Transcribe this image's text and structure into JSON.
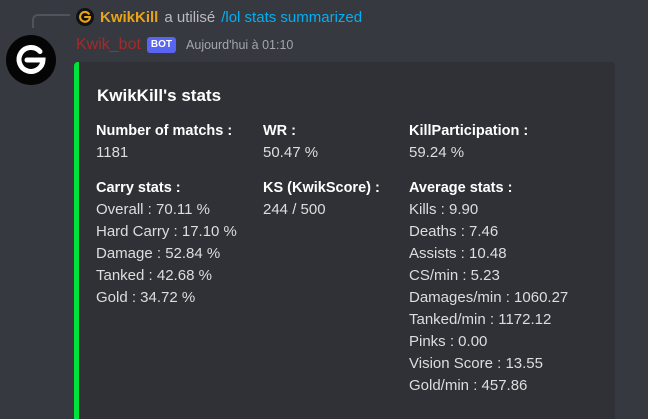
{
  "reply": {
    "user_name": "KwikKill",
    "verb": "a utilisé",
    "command": "/lol stats summarized"
  },
  "author": {
    "name": "Kwik_bot",
    "tag": "BOT",
    "timestamp": "Aujourd'hui à 01:10"
  },
  "embed": {
    "accent_color": "#00e33a",
    "title": "KwikKill's stats",
    "fields": {
      "matches": {
        "name": "Number of matchs :",
        "value": "1181"
      },
      "wr": {
        "name": "WR :",
        "value": "50.47 %"
      },
      "kp": {
        "name": "KillParticipation :",
        "value": "59.24 %"
      },
      "carry": {
        "name": "Carry stats :",
        "lines": [
          "Overall : 70.11 %",
          "Hard Carry : 17.10 %",
          "Damage : 52.84 %",
          "Tanked : 42.68 %",
          "Gold : 34.72 %"
        ]
      },
      "ks": {
        "name": "KS (KwikScore) :",
        "value": "244 / 500"
      },
      "average": {
        "name": "Average stats :",
        "lines": [
          "Kills : 9.90",
          "Deaths : 7.46",
          "Assists : 10.48",
          "CS/min : 5.23",
          "Damages/min : 1060.27",
          "Tanked/min : 1172.12",
          "Pinks : 0.00",
          "Vision Score : 13.55",
          "Gold/min : 457.86"
        ]
      }
    }
  },
  "colors": {
    "background": "#36393f",
    "embed_bg": "#2f3136",
    "bot_name": "#a52a2a",
    "reply_user": "#e8a317",
    "command": "#00b0f4",
    "bot_tag": "#5865f2"
  },
  "icons": {
    "avatar": "g-logo-icon",
    "reply_avatar": "g-logo-icon"
  }
}
